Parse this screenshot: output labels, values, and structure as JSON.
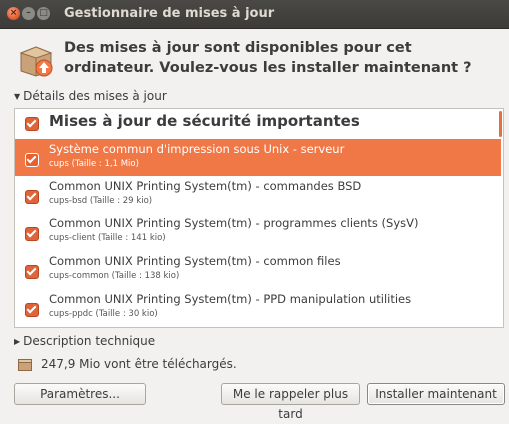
{
  "window": {
    "title": "Gestionnaire de mises à jour",
    "close_glyph": "×",
    "minimize_glyph": "–",
    "maximize_glyph": "□"
  },
  "header": {
    "message": "Des mises à jour sont disponibles pour cet ordinateur. Voulez-vous les installer maintenant ?",
    "icon": "package-update-icon"
  },
  "details": {
    "toggle_label": "Détails des mises à jour",
    "expanded": true
  },
  "update_list": {
    "category": {
      "label": "Mises à jour de sécurité importantes",
      "checked": true
    },
    "items": [
      {
        "title": "Système commun d'impression sous Unix - serveur",
        "subtitle": "cups (Taille : 1,1 Mio)",
        "checked": true,
        "selected": true
      },
      {
        "title": "Common UNIX Printing System(tm) - commandes BSD",
        "subtitle": "cups-bsd (Taille : 29 kio)",
        "checked": true,
        "selected": false
      },
      {
        "title": "Common UNIX Printing System(tm) - programmes clients (SysV)",
        "subtitle": "cups-client (Taille : 141 kio)",
        "checked": true,
        "selected": false
      },
      {
        "title": "Common UNIX Printing System(tm) - common files",
        "subtitle": "cups-common (Taille : 138 kio)",
        "checked": true,
        "selected": false
      },
      {
        "title": "Common UNIX Printing System(tm) - PPD manipulation utilities",
        "subtitle": "cups-ppdc (Taille : 30 kio)",
        "checked": true,
        "selected": false
      }
    ]
  },
  "technical": {
    "toggle_label": "Description technique",
    "expanded": false
  },
  "download": {
    "text": "247,9 Mio vont être téléchargés.",
    "icon": "download-size-icon"
  },
  "buttons": {
    "settings": "Paramètres...",
    "remind_later": "Me le rappeler plus tard",
    "install_now": "Installer maintenant"
  },
  "colors": {
    "accent": "#f07746",
    "titlebar": "#3c3b37",
    "background": "#f2f1f0"
  }
}
